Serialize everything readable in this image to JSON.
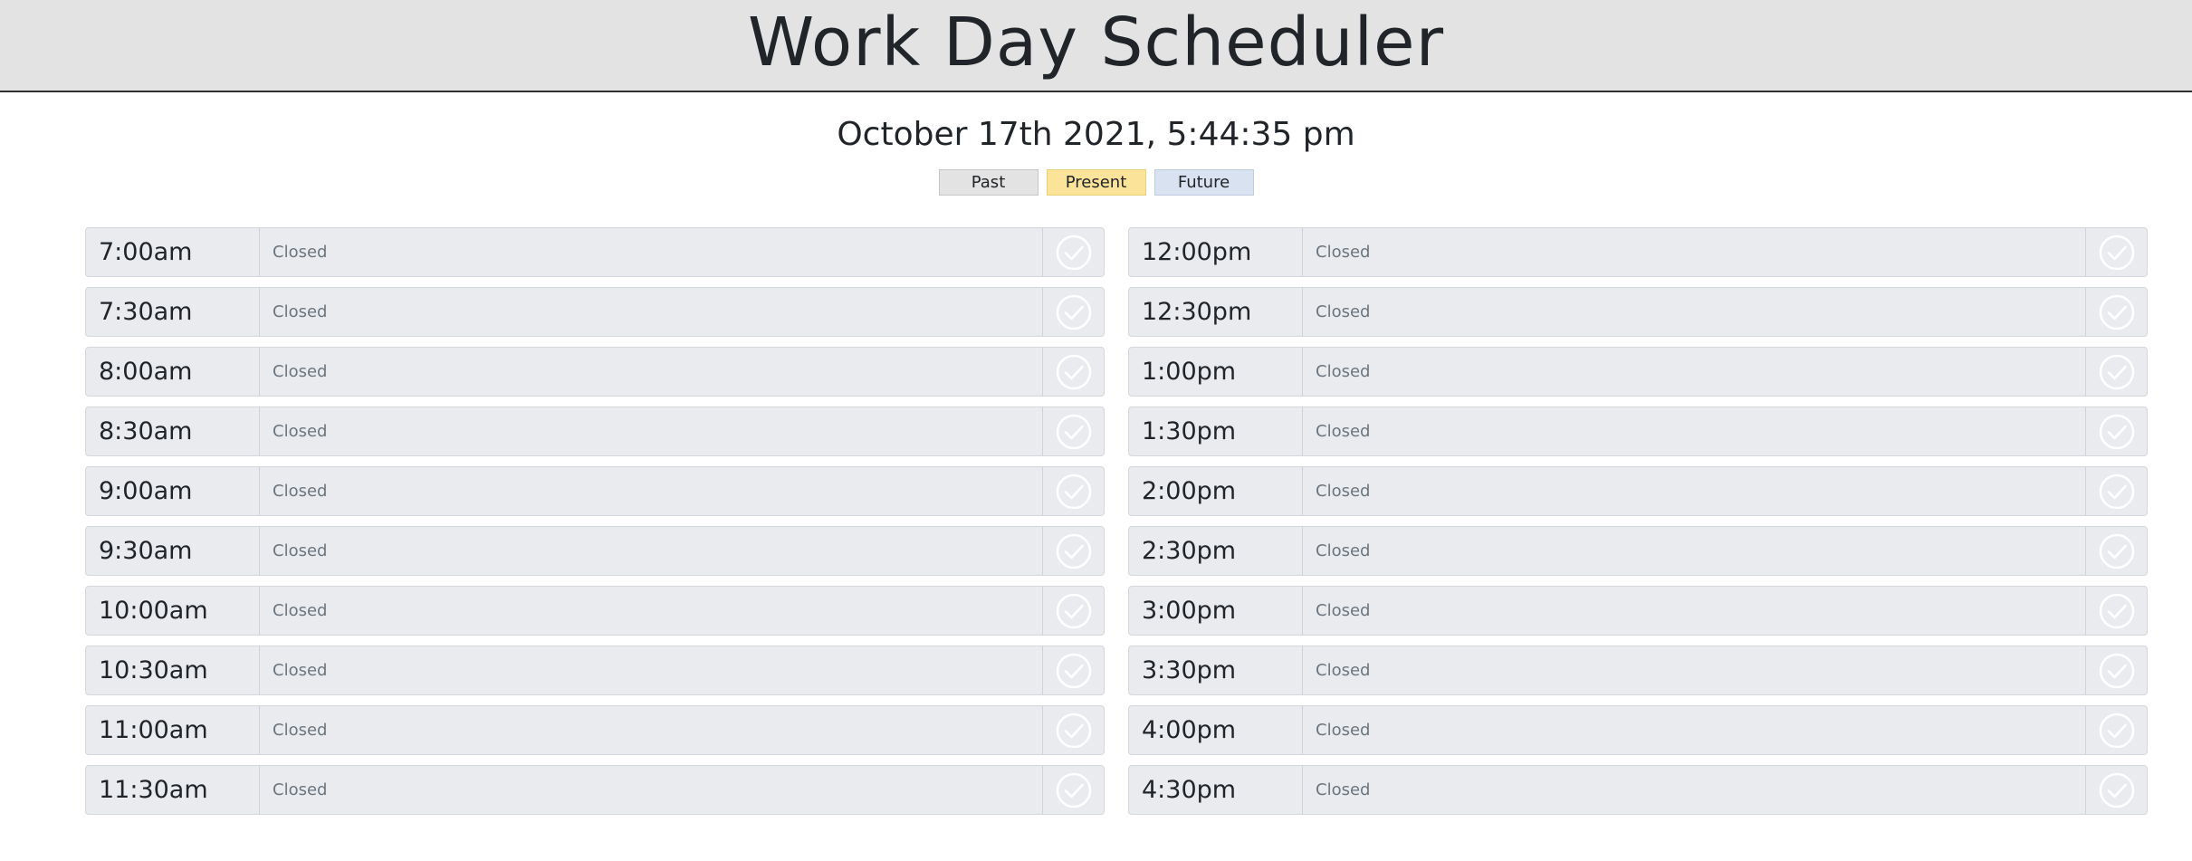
{
  "header": {
    "title": "Work Day Scheduler"
  },
  "clock": {
    "text": "October 17th 2021, 5:44:35 pm"
  },
  "legend": {
    "past": "Past",
    "present": "Present",
    "future": "Future"
  },
  "colors": {
    "past": "#e3e3e3",
    "present": "#fbe39a",
    "future": "#d9e2f0",
    "header_bg": "#e3e3e3"
  },
  "slots_left": [
    {
      "time": "7:00am",
      "status": "Closed"
    },
    {
      "time": "7:30am",
      "status": "Closed"
    },
    {
      "time": "8:00am",
      "status": "Closed"
    },
    {
      "time": "8:30am",
      "status": "Closed"
    },
    {
      "time": "9:00am",
      "status": "Closed"
    },
    {
      "time": "9:30am",
      "status": "Closed"
    },
    {
      "time": "10:00am",
      "status": "Closed"
    },
    {
      "time": "10:30am",
      "status": "Closed"
    },
    {
      "time": "11:00am",
      "status": "Closed"
    },
    {
      "time": "11:30am",
      "status": "Closed"
    }
  ],
  "slots_right": [
    {
      "time": "12:00pm",
      "status": "Closed"
    },
    {
      "time": "12:30pm",
      "status": "Closed"
    },
    {
      "time": "1:00pm",
      "status": "Closed"
    },
    {
      "time": "1:30pm",
      "status": "Closed"
    },
    {
      "time": "2:00pm",
      "status": "Closed"
    },
    {
      "time": "2:30pm",
      "status": "Closed"
    },
    {
      "time": "3:00pm",
      "status": "Closed"
    },
    {
      "time": "3:30pm",
      "status": "Closed"
    },
    {
      "time": "4:00pm",
      "status": "Closed"
    },
    {
      "time": "4:30pm",
      "status": "Closed"
    }
  ],
  "save_icon": "check-circle-icon"
}
